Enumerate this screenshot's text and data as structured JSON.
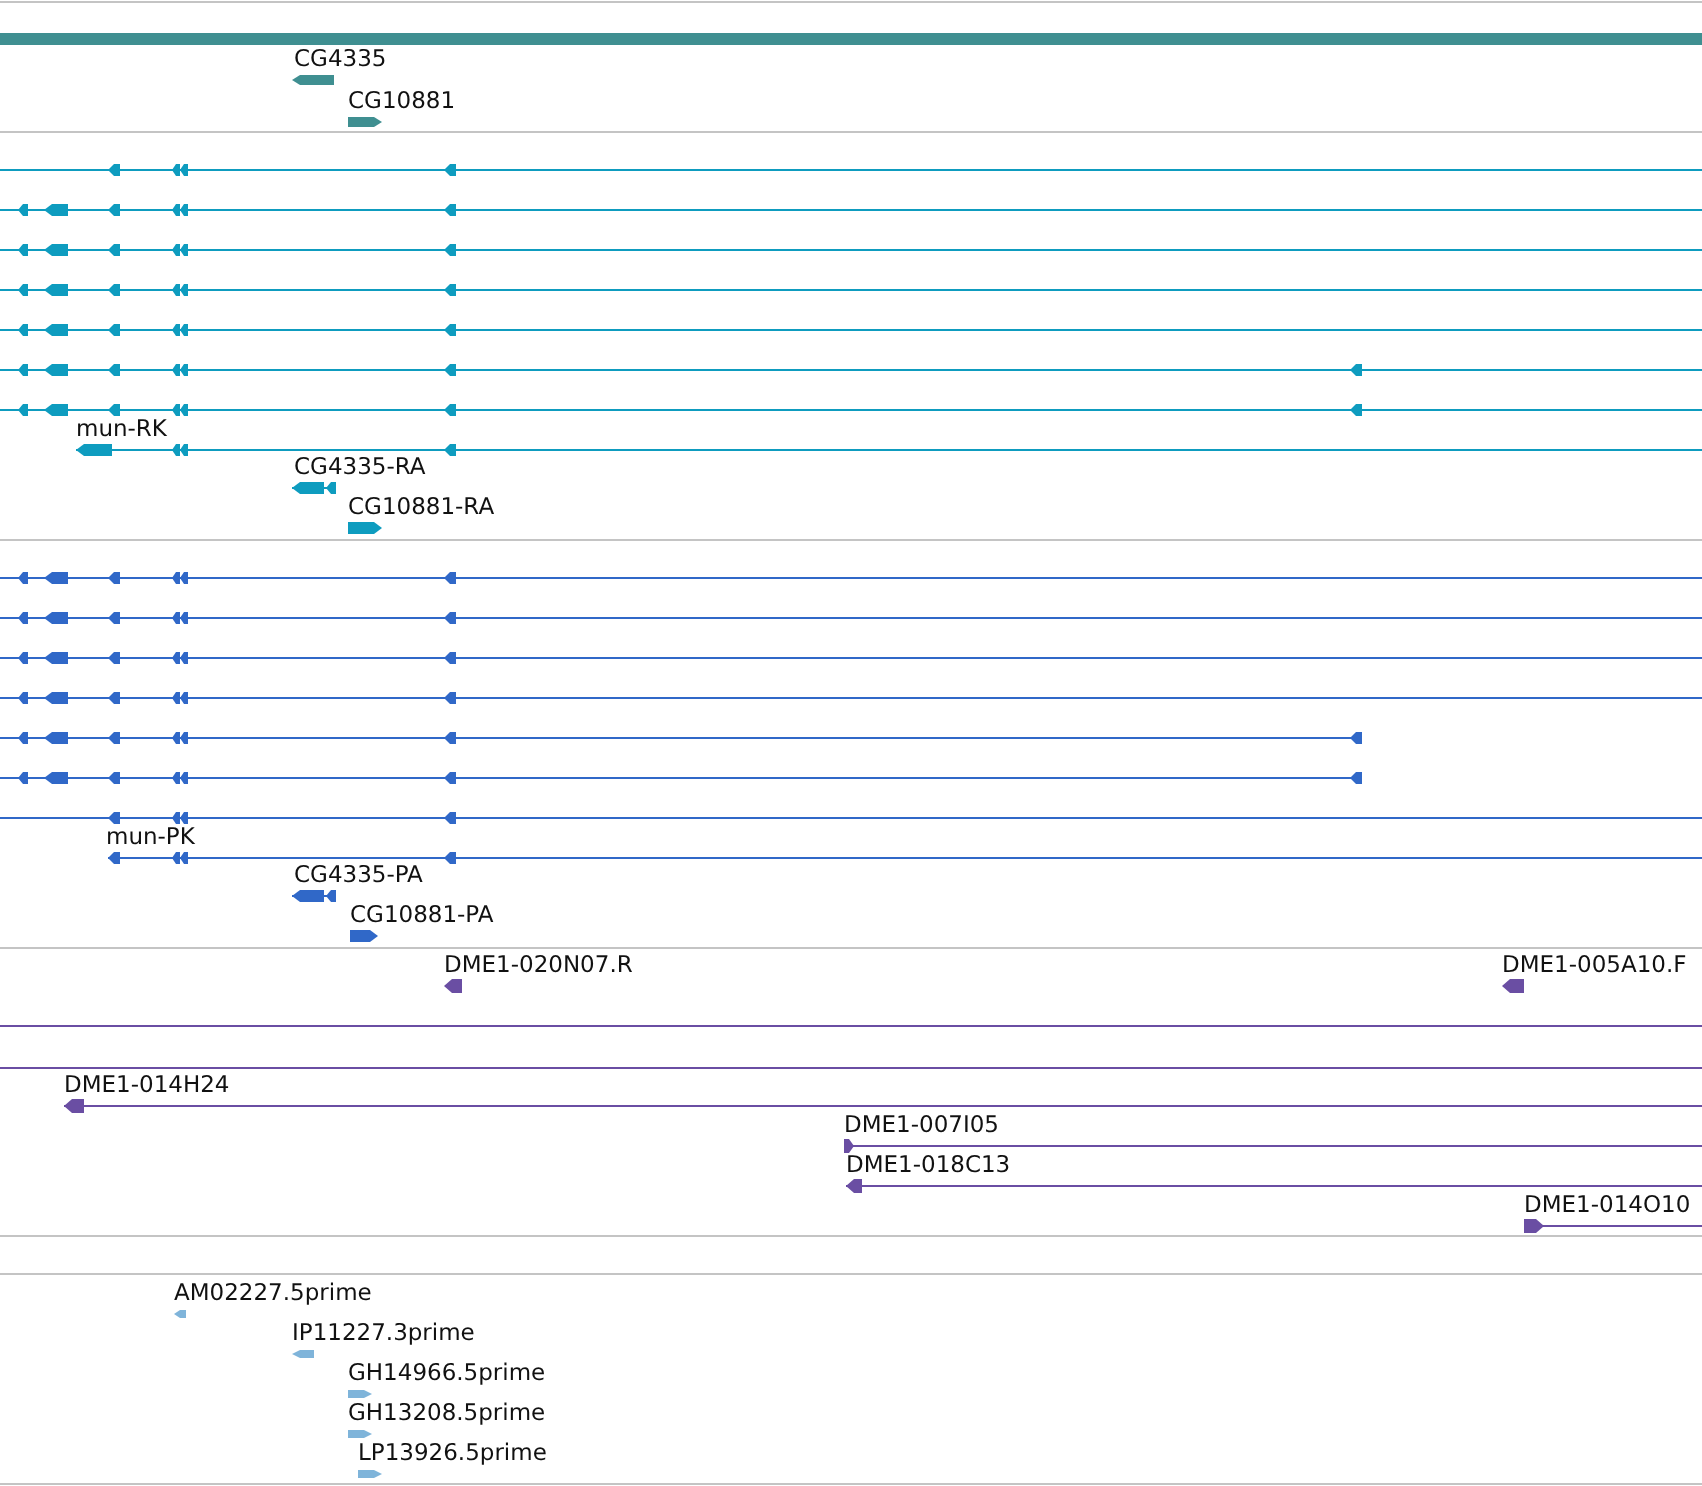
{
  "tracks": [
    {
      "kind": "gene",
      "color": "#3f8f91",
      "features": [
        {
          "kind": "bar"
        },
        {
          "kind": "model",
          "label": "CG4335",
          "reverse": true
        },
        {
          "kind": "model",
          "label": "CG10881",
          "reverse": false
        }
      ]
    },
    {
      "kind": "transcript",
      "color": "#0e9cbf",
      "features": [
        {
          "kind": "model",
          "reverse": true
        },
        {
          "kind": "model",
          "reverse": true
        },
        {
          "kind": "model",
          "reverse": true
        },
        {
          "kind": "model",
          "reverse": true
        },
        {
          "kind": "model",
          "reverse": true
        },
        {
          "kind": "model",
          "reverse": true
        },
        {
          "kind": "model",
          "reverse": true
        },
        {
          "kind": "model",
          "label": "mun-RK",
          "reverse": true
        },
        {
          "kind": "model",
          "label": "CG4335-RA",
          "reverse": true
        },
        {
          "kind": "model",
          "label": "CG10881-RA",
          "reverse": false
        }
      ]
    },
    {
      "kind": "transcript",
      "color": "#3068c8",
      "features": [
        {
          "kind": "model",
          "reverse": true
        },
        {
          "kind": "model",
          "reverse": true
        },
        {
          "kind": "model",
          "reverse": true
        },
        {
          "kind": "model",
          "reverse": true
        },
        {
          "kind": "model",
          "reverse": true
        },
        {
          "kind": "model",
          "reverse": true
        },
        {
          "kind": "model",
          "reverse": true
        },
        {
          "kind": "model",
          "label": "mun-PK",
          "reverse": true
        },
        {
          "kind": "model",
          "label": "CG4335-PA",
          "reverse": true
        },
        {
          "kind": "model",
          "label": "CG10881-PA",
          "reverse": false
        }
      ]
    },
    {
      "kind": "clone",
      "color": "#6a4ea3",
      "features": [
        {
          "kind": "model",
          "label": "DME1-020N07.R",
          "reverse": true
        },
        {
          "kind": "model",
          "label": "DME1-005A10.F",
          "reverse": true
        },
        {
          "kind": "line"
        },
        {
          "kind": "line"
        },
        {
          "kind": "model",
          "label": "DME1-014H24",
          "reverse": true
        },
        {
          "kind": "model",
          "label": "DME1-007I05",
          "reverse": false
        },
        {
          "kind": "model",
          "label": "DME1-018C13",
          "reverse": true
        },
        {
          "kind": "model",
          "label": "DME1-014O10",
          "reverse": false
        }
      ]
    },
    {
      "kind": "est",
      "color": "#7fb4da",
      "features": [
        {
          "kind": "model",
          "label": "AM02227.5prime",
          "reverse": true
        },
        {
          "kind": "model",
          "label": "IP11227.3prime",
          "reverse": true
        },
        {
          "kind": "model",
          "label": "GH14966.5prime",
          "reverse": false
        },
        {
          "kind": "model",
          "label": "GH13208.5prime",
          "reverse": false
        },
        {
          "kind": "model",
          "label": "LP13926.5prime",
          "reverse": false
        }
      ]
    }
  ]
}
